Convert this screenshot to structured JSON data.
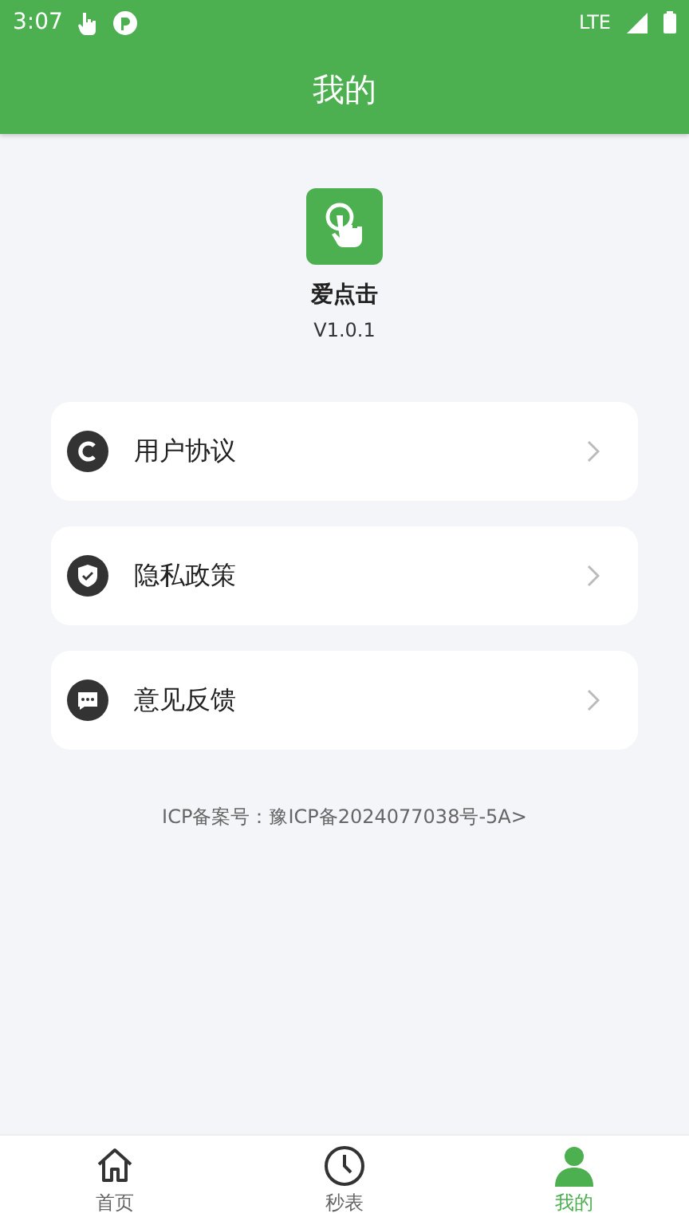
{
  "status_bar": {
    "time": "3:07",
    "network": "LTE"
  },
  "header": {
    "title": "我的"
  },
  "app": {
    "name": "爱点击",
    "version": "V1.0.1"
  },
  "menu": [
    {
      "kind": "agreement",
      "label": "用户协议"
    },
    {
      "kind": "privacy",
      "label": "隐私政策"
    },
    {
      "kind": "feedback",
      "label": "意见反馈"
    }
  ],
  "icp": "ICP备案号：豫ICP备2024077038号-5A>",
  "tabs": [
    {
      "kind": "home",
      "label": "首页",
      "selected": false
    },
    {
      "kind": "clock",
      "label": "秒表",
      "selected": false
    },
    {
      "kind": "person",
      "label": "我的",
      "selected": true
    }
  ]
}
